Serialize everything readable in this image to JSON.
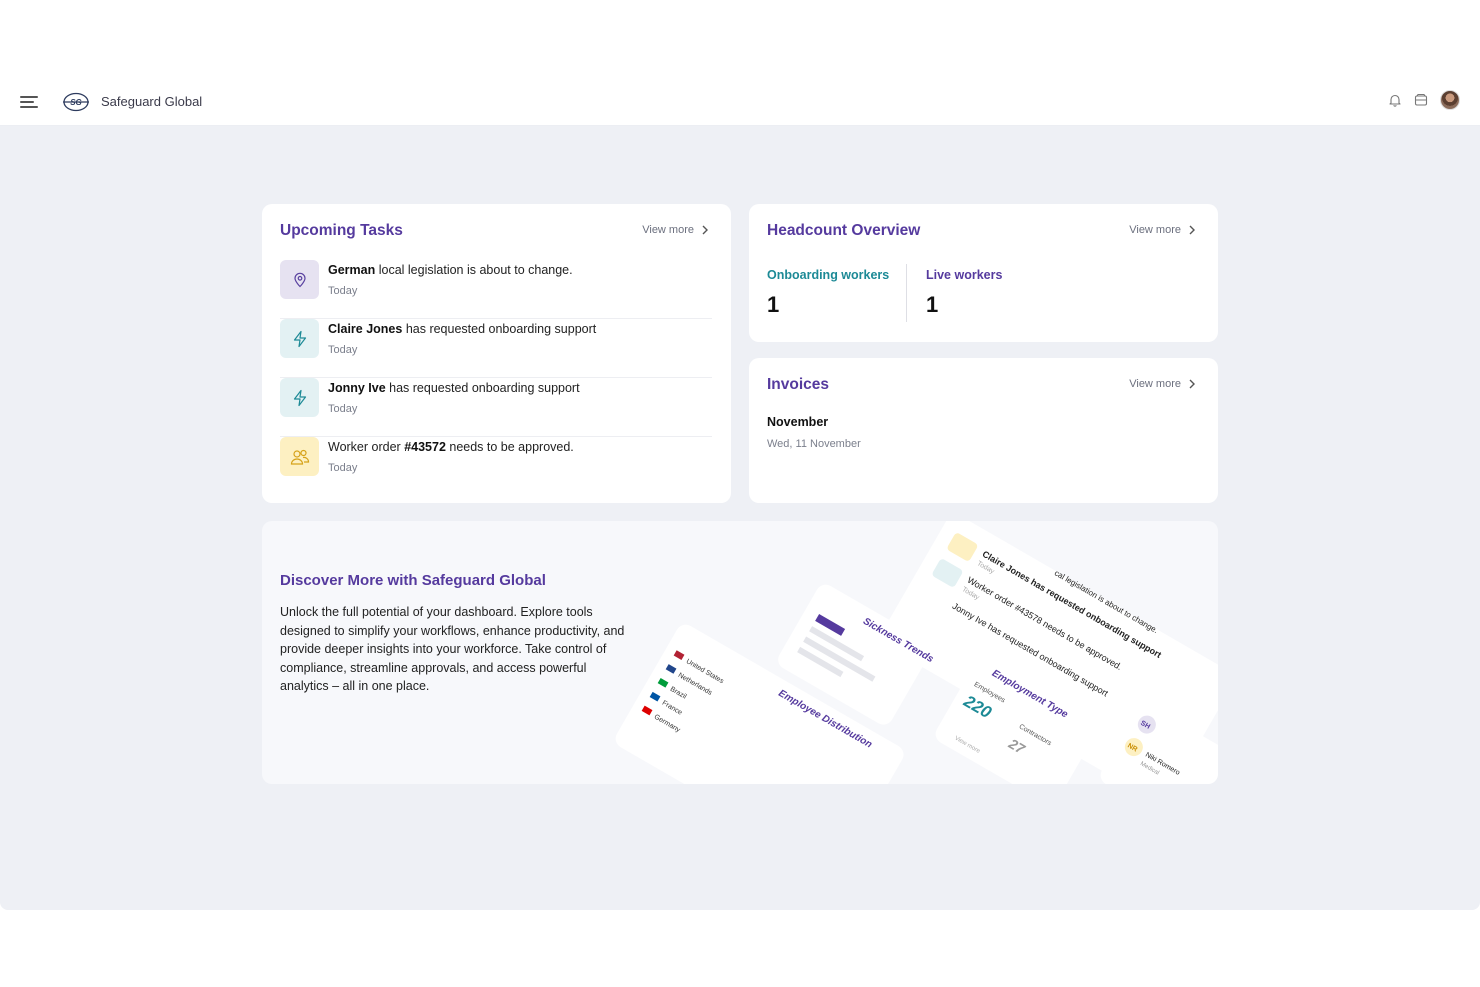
{
  "app": {
    "brand": "Safeguard Global"
  },
  "header": {
    "icons": [
      "menu-icon",
      "logo-icon",
      "bell-icon",
      "inbox-icon",
      "avatar"
    ]
  },
  "colors": {
    "accent": "#553a9e",
    "teal": "#1d8a96",
    "background": "#eef0f5",
    "task_purple_bg": "#e6e2f1",
    "task_teal_bg": "#e3f1f3",
    "task_yellow_bg": "#fdf0c2"
  },
  "tasks": {
    "title": "Upcoming Tasks",
    "view_more": "View more",
    "items": [
      {
        "icon": "location-pin-icon",
        "bold": "German",
        "rest": " local legislation is about to change.",
        "date": "Today"
      },
      {
        "icon": "lightning-icon",
        "bold": "Claire Jones",
        "rest": " has requested onboarding support",
        "date": "Today"
      },
      {
        "icon": "lightning-icon",
        "bold": "Jonny Ive",
        "rest": " has requested onboarding support",
        "date": "Today"
      },
      {
        "icon": "users-icon",
        "prefix": "Worker order ",
        "bold": "#43572",
        "rest": " needs to be approved.",
        "date": "Today"
      }
    ]
  },
  "headcount": {
    "title": "Headcount Overview",
    "view_more": "View more",
    "onboarding_label": "Onboarding workers",
    "onboarding_value": "1",
    "live_label": "Live workers",
    "live_value": "1"
  },
  "invoices": {
    "title": "Invoices",
    "view_more": "View more",
    "month": "November",
    "date": "Wed, 11 November"
  },
  "discover": {
    "title": "Discover More with Safeguard Global",
    "body": "Unlock the full potential of your dashboard. Explore tools designed to simplify your workflows, enhance productivity, and provide deeper insights into your workforce. Take control of compliance, streamline approvals, and access powerful analytics – all in one place.",
    "illustration": {
      "tasks_lines": [
        "Claire Jones has requested onboarding support",
        "Worker order #43578 needs to be approved.",
        "Jonny Ive has requested onboarding support",
        "cal legislation is about to change."
      ],
      "today": "Today",
      "sickness": "Sickness Trends",
      "distribution": "Employee Distribution",
      "countries": [
        "United States",
        "Netherlands",
        "Brazil",
        "France",
        "Germany"
      ],
      "employment_type": "Employment Type",
      "employees_label": "Employees",
      "employees_value": "220",
      "contractors_label": "Contractors",
      "contractors_value": "27",
      "view_more": "View more",
      "people": [
        "SH",
        "NR",
        "Niki Romero",
        "Medical"
      ]
    }
  }
}
